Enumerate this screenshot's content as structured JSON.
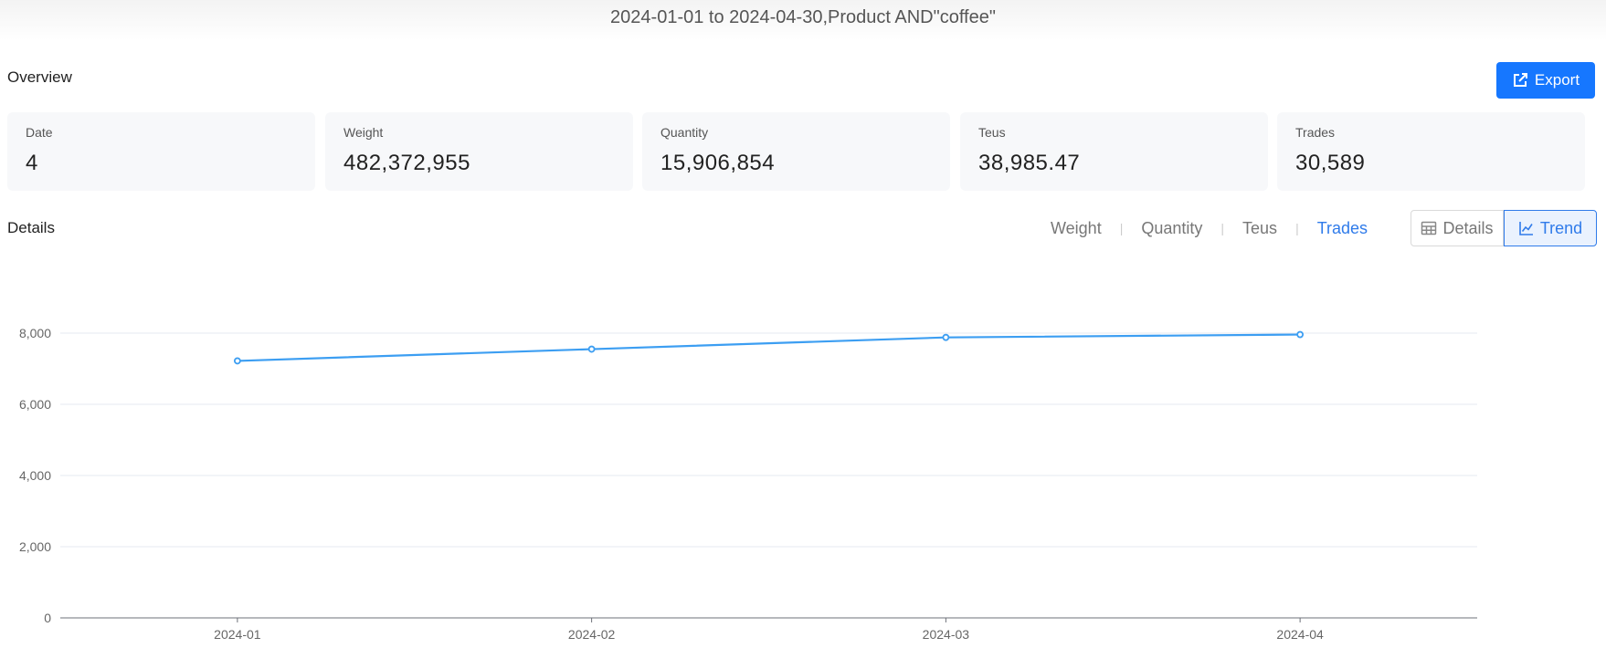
{
  "header": {
    "query_title": "2024-01-01 to 2024-04-30,Product AND\"coffee\""
  },
  "overview": {
    "title": "Overview",
    "export_label": "Export",
    "cards": [
      {
        "label": "Date",
        "value": "4"
      },
      {
        "label": "Weight",
        "value": "482,372,955"
      },
      {
        "label": "Quantity",
        "value": "15,906,854"
      },
      {
        "label": "Teus",
        "value": "38,985.47"
      },
      {
        "label": "Trades",
        "value": "30,589"
      }
    ]
  },
  "details": {
    "title": "Details",
    "metric_tabs": [
      "Weight",
      "Quantity",
      "Teus",
      "Trades"
    ],
    "active_metric": "Trades",
    "view_buttons": {
      "details": "Details",
      "trend": "Trend"
    },
    "active_view": "Trend"
  },
  "chart_data": {
    "type": "line",
    "categories": [
      "2024-01",
      "2024-02",
      "2024-03",
      "2024-04"
    ],
    "values": [
      7220,
      7550,
      7880,
      7960
    ],
    "y_ticks": [
      0,
      2000,
      4000,
      6000,
      8000
    ],
    "y_tick_labels": [
      "0",
      "2,000",
      "4,000",
      "6,000",
      "8,000"
    ],
    "ylim": [
      0,
      8000
    ],
    "grid": true,
    "line_color": "#3c9ef2",
    "title": "",
    "xlabel": "",
    "ylabel": ""
  }
}
